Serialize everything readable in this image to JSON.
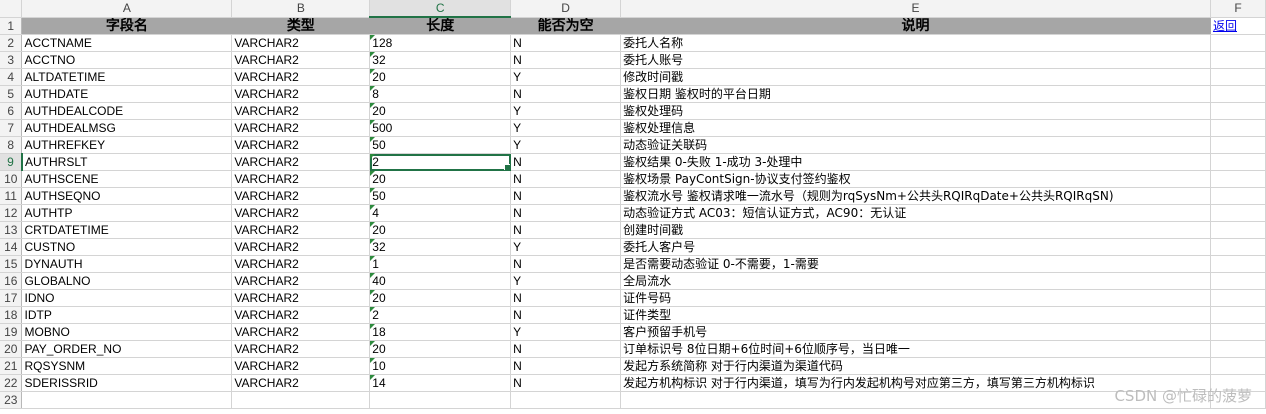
{
  "columns": [
    "A",
    "B",
    "C",
    "D",
    "E",
    "F"
  ],
  "header_row": {
    "row_number": "1",
    "field": "字段名",
    "type": "类型",
    "length": "长度",
    "nullable": "能否为空",
    "description": "说明",
    "back_link": "返回"
  },
  "rows": [
    {
      "n": "2",
      "field": "ACCTNAME",
      "type": "VARCHAR2",
      "length": "128",
      "nullable": "N",
      "desc": "委托人名称"
    },
    {
      "n": "3",
      "field": "ACCTNO",
      "type": "VARCHAR2",
      "length": "32",
      "nullable": "N",
      "desc": "委托人账号"
    },
    {
      "n": "4",
      "field": "ALTDATETIME",
      "type": "VARCHAR2",
      "length": "20",
      "nullable": "Y",
      "desc": "修改时间戳"
    },
    {
      "n": "5",
      "field": "AUTHDATE",
      "type": "VARCHAR2",
      "length": "8",
      "nullable": "N",
      "desc": "鉴权日期 鉴权时的平台日期"
    },
    {
      "n": "6",
      "field": "AUTHDEALCODE",
      "type": "VARCHAR2",
      "length": "20",
      "nullable": "Y",
      "desc": "鉴权处理码"
    },
    {
      "n": "7",
      "field": "AUTHDEALMSG",
      "type": "VARCHAR2",
      "length": "500",
      "nullable": "Y",
      "desc": "鉴权处理信息"
    },
    {
      "n": "8",
      "field": "AUTHREFKEY",
      "type": "VARCHAR2",
      "length": "50",
      "nullable": "Y",
      "desc": "动态验证关联码"
    },
    {
      "n": "9",
      "field": "AUTHRSLT",
      "type": "VARCHAR2",
      "length": "2",
      "nullable": "N",
      "desc": "鉴权结果 0-失败 1-成功 3-处理中"
    },
    {
      "n": "10",
      "field": "AUTHSCENE",
      "type": "VARCHAR2",
      "length": "20",
      "nullable": "N",
      "desc": "鉴权场景 PayContSign-协议支付签约鉴权"
    },
    {
      "n": "11",
      "field": "AUTHSEQNO",
      "type": "VARCHAR2",
      "length": "50",
      "nullable": "N",
      "desc": "鉴权流水号 鉴权请求唯一流水号（规则为rqSysNm+公共头RQIRqDate+公共头RQIRqSN)"
    },
    {
      "n": "12",
      "field": "AUTHTP",
      "type": "VARCHAR2",
      "length": "4",
      "nullable": "N",
      "desc": "动态验证方式 AC03：短信认证方式，AC90：无认证"
    },
    {
      "n": "13",
      "field": "CRTDATETIME",
      "type": "VARCHAR2",
      "length": "20",
      "nullable": "N",
      "desc": "创建时间戳"
    },
    {
      "n": "14",
      "field": "CUSTNO",
      "type": "VARCHAR2",
      "length": "32",
      "nullable": "Y",
      "desc": "委托人客户号"
    },
    {
      "n": "15",
      "field": "DYNAUTH",
      "type": "VARCHAR2",
      "length": "1",
      "nullable": "N",
      "desc": "是否需要动态验证 0-不需要，1-需要"
    },
    {
      "n": "16",
      "field": "GLOBALNO",
      "type": "VARCHAR2",
      "length": "40",
      "nullable": "Y",
      "desc": "全局流水"
    },
    {
      "n": "17",
      "field": "IDNO",
      "type": "VARCHAR2",
      "length": "20",
      "nullable": "N",
      "desc": "证件号码"
    },
    {
      "n": "18",
      "field": "IDTP",
      "type": "VARCHAR2",
      "length": "2",
      "nullable": "N",
      "desc": "证件类型"
    },
    {
      "n": "19",
      "field": "MOBNO",
      "type": "VARCHAR2",
      "length": "18",
      "nullable": "Y",
      "desc": "客户预留手机号"
    },
    {
      "n": "20",
      "field": "PAY_ORDER_NO",
      "type": "VARCHAR2",
      "length": "20",
      "nullable": "N",
      "desc": "订单标识号 8位日期+6位时间+6位顺序号，当日唯一"
    },
    {
      "n": "21",
      "field": "RQSYSNM",
      "type": "VARCHAR2",
      "length": "10",
      "nullable": "N",
      "desc": "发起方系统简称 对于行内渠道为渠道代码"
    },
    {
      "n": "22",
      "field": "SDERISSRID",
      "type": "VARCHAR2",
      "length": "14",
      "nullable": "N",
      "desc": "发起方机构标识 对于行内渠道，填写为行内发起机构号对应第三方，填写第三方机构标识"
    },
    {
      "n": "23",
      "field": "",
      "type": "",
      "length": "",
      "nullable": "",
      "desc": ""
    }
  ],
  "selected_cell": "C9",
  "watermark": "CSDN @忙碌的菠萝"
}
